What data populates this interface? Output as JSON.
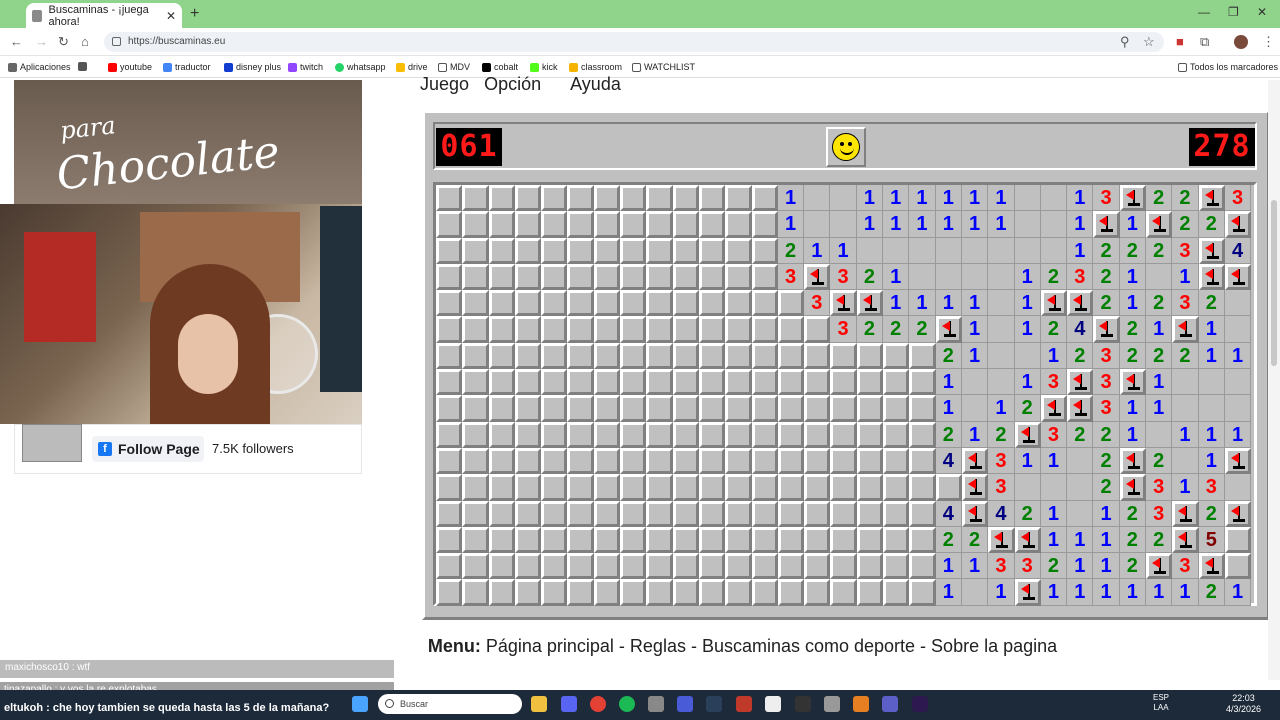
{
  "browser": {
    "tab_title": "Buscaminas - ¡juega ahora!",
    "url": "https://buscaminas.eu",
    "bookmarks": [
      "Aplicaciones",
      "youtube",
      "traductor",
      "disney plus",
      "twitch",
      "whatsapp",
      "drive",
      "MDV",
      "cobalt",
      "kick",
      "classroom",
      "WATCHLIST"
    ],
    "bookmarks_right": "Todos los marcadores"
  },
  "stream": {
    "overlay_line1": "para",
    "overlay_line2": "Chocolate",
    "follow_button": "Follow Page",
    "followers": "7.5K followers"
  },
  "game": {
    "menu": [
      "Juego",
      "Opción",
      "Ayuda"
    ],
    "mines_left": "061",
    "timer": "278",
    "face": "smiley",
    "board_rows": [
      "ccccccccccccc1__111111__13F22F3",
      "ccccccccccccc1__111111__1F1F22F",
      "ccccccccccccc211________12223F4F3",
      "ccccccccccccc3F321____12321_1FF1",
      "cccccccccccccc3FF1111_1FF21232 1",
      "ccccccccccccccc3222F1_124F21F1__",
      "ccccccccccccccccccc21__12322211__",
      "ccccccccccccccccccc1__13F3F1____",
      "ccccccccccccccccccc1_12FF311____",
      "ccccccccccccccccccc212F3221_111",
      "ccccccccccccccccccc4F311_2F2_1F2",
      "ccccccccccccccccccccF3___2F313_",
      "ccccccccccccccccccc4F421_123F2Fc",
      "ccccccccccccccccccc22FF11122F5cc",
      "ccccccccccccccccccc11332112F3Fcc",
      "ccccccccccccccccccc1_1F11111121Fcc"
    ]
  },
  "footer": {
    "menu_label": "Menu:",
    "menu_items": "Página principal - Reglas - Buscaminas como deporte - Sobre la pagina"
  },
  "chat": {
    "line1": "maxichosco10 : wtf",
    "line2": "tinazapallo : y vos la re explotabas",
    "line3": "eltukoh : che hoy tambien se queda hasta las 5 de la mañana?"
  },
  "taskbar": {
    "search_placeholder": "Buscar",
    "lang": "ESP\nLAA",
    "time": "22:03",
    "date": "4/3/2026"
  },
  "colors": {
    "tabbar": "#8fd48a",
    "board": "#c0c0c0",
    "lcd": "#ff1a1a",
    "taskbar": "#1d2a3a"
  }
}
